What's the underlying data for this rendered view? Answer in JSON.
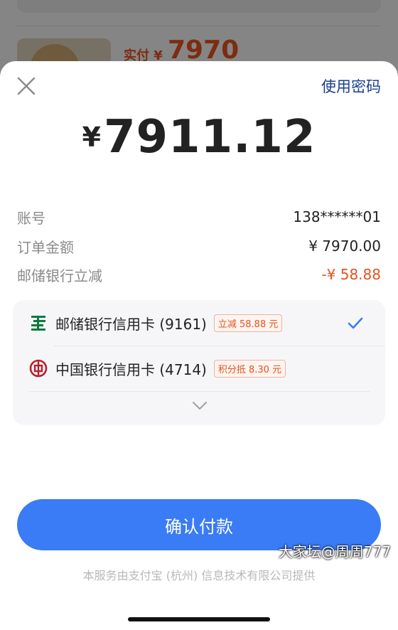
{
  "background": {
    "price_label": "实付 ¥",
    "price_value": "7970"
  },
  "header": {
    "use_password": "使用密码"
  },
  "payment": {
    "currency": "¥",
    "amount": "7911.12"
  },
  "info": [
    {
      "key": "账号",
      "value": "138******01"
    },
    {
      "key": "订单金额",
      "value": "¥ 7970.00"
    },
    {
      "key": "邮储银行立减",
      "value": "-¥ 58.88"
    }
  ],
  "cards": [
    {
      "name": "邮储银行信用卡 (9161)",
      "badge": "立减 58.88 元",
      "selected": true,
      "icon": "psbc-logo-icon"
    },
    {
      "name": "中国银行信用卡 (4714)",
      "badge": "积分抵 8.30 元",
      "selected": false,
      "icon": "boc-logo-icon"
    }
  ],
  "confirm_label": "确认付款",
  "footer_text": "本服务由支付宝 (杭州) 信息技术有限公司提供",
  "watermark": "大家坛@周周777",
  "colors": {
    "accent": "#3a7bf6",
    "discount": "#e2531e",
    "link": "#1b3f8f"
  }
}
